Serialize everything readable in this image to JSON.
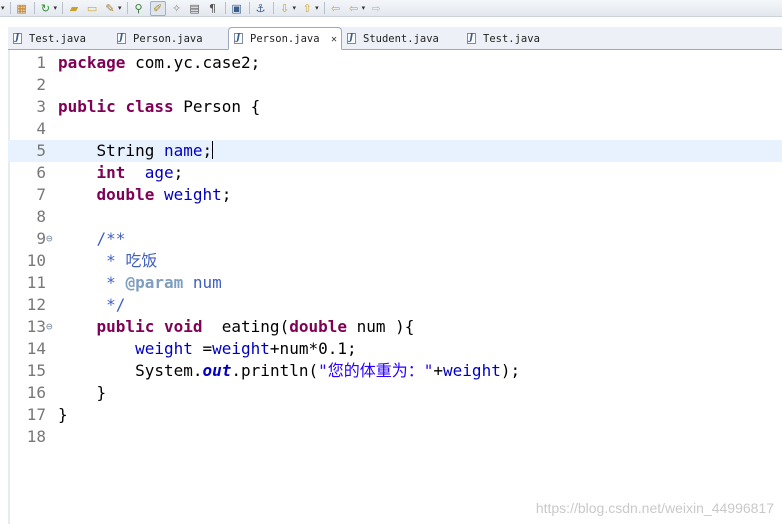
{
  "toolbar": {
    "icons": [
      "new-package-icon",
      "run-icon",
      "open-type-icon",
      "open-folder-icon",
      "search-icon",
      "debug-icon",
      "pen-icon",
      "wand-icon",
      "toggle-block-icon",
      "show-whitespace-icon",
      "console-icon",
      "pin-icon",
      "next-annotation-icon",
      "prev-annotation-icon",
      "back-icon",
      "forward-icon"
    ]
  },
  "tabs": [
    {
      "label": "Test.java",
      "active": false
    },
    {
      "label": "Person.java",
      "active": false
    },
    {
      "label": "Person.java",
      "active": true
    },
    {
      "label": "Student.java",
      "active": false
    },
    {
      "label": "Test.java",
      "active": false
    }
  ],
  "editor": {
    "lines": [
      {
        "n": "1",
        "t": [
          [
            "kw",
            "package"
          ],
          [
            "",
            " com.yc.case2;"
          ]
        ]
      },
      {
        "n": "2",
        "t": []
      },
      {
        "n": "3",
        "t": [
          [
            "kw",
            "public"
          ],
          [
            "",
            " "
          ],
          [
            "kw",
            "class"
          ],
          [
            "",
            " Person {"
          ]
        ]
      },
      {
        "n": "4",
        "t": []
      },
      {
        "n": "5",
        "t": [
          [
            "",
            "    String "
          ],
          [
            "fld",
            "name"
          ],
          [
            "",
            ";"
          ]
        ]
      },
      {
        "n": "6",
        "t": [
          [
            "",
            "    "
          ],
          [
            "kw",
            "int"
          ],
          [
            "",
            "  "
          ],
          [
            "fld",
            "age"
          ],
          [
            "",
            ";"
          ]
        ]
      },
      {
        "n": "7",
        "t": [
          [
            "",
            "    "
          ],
          [
            "kw",
            "double"
          ],
          [
            "",
            " "
          ],
          [
            "fld",
            "weight"
          ],
          [
            "",
            ";"
          ]
        ]
      },
      {
        "n": "8",
        "t": []
      },
      {
        "n": "9",
        "t": [
          [
            "cm",
            "    /**"
          ]
        ]
      },
      {
        "n": "10",
        "t": [
          [
            "cm",
            "     * 吃饭"
          ]
        ]
      },
      {
        "n": "11",
        "t": [
          [
            "cm",
            "     * "
          ],
          [
            "tag",
            "@param"
          ],
          [
            "cm",
            " num"
          ]
        ]
      },
      {
        "n": "12",
        "t": [
          [
            "cm",
            "     */"
          ]
        ]
      },
      {
        "n": "13",
        "t": [
          [
            "",
            "    "
          ],
          [
            "kw",
            "public"
          ],
          [
            "",
            " "
          ],
          [
            "kw",
            "void"
          ],
          [
            "",
            "  eating("
          ],
          [
            "kw",
            "double"
          ],
          [
            "",
            " num ){"
          ]
        ]
      },
      {
        "n": "14",
        "t": [
          [
            "",
            "        "
          ],
          [
            "fld",
            "weight"
          ],
          [
            "",
            " ="
          ],
          [
            "fld",
            "weight"
          ],
          [
            "",
            "+num*0.1;"
          ]
        ]
      },
      {
        "n": "15",
        "t": [
          [
            "",
            "        System."
          ],
          [
            "sfld",
            "out"
          ],
          [
            "",
            ".println("
          ],
          [
            "str",
            "\"您的体重为：\""
          ],
          [
            "",
            "+"
          ],
          [
            "fld",
            "weight"
          ],
          [
            "",
            ");"
          ]
        ]
      },
      {
        "n": "16",
        "t": [
          [
            "",
            "    }"
          ]
        ]
      },
      {
        "n": "17",
        "t": [
          [
            "",
            "}"
          ]
        ]
      },
      {
        "n": "18",
        "t": []
      }
    ],
    "current_line": "5",
    "fold_lines": [
      "9",
      "13"
    ]
  },
  "watermark": "https://blog.csdn.net/weixin_44996817"
}
